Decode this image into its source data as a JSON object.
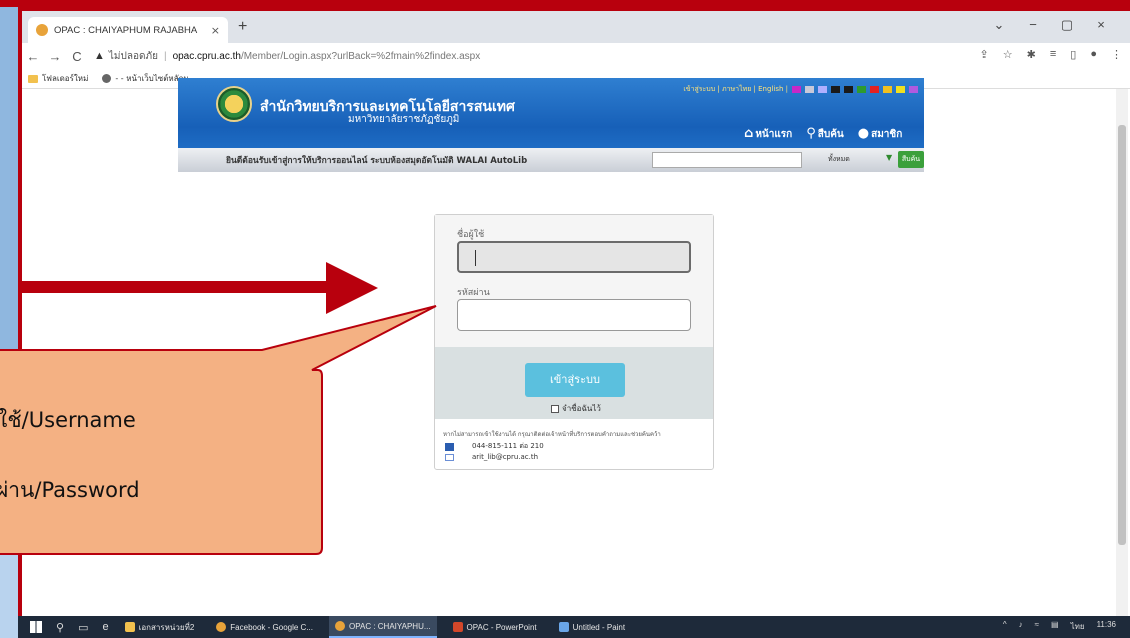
{
  "browser": {
    "tab_title": "OPAC : CHAIYAPHUM RAJABHA",
    "tab_close": "×",
    "new_tab": "+",
    "window_controls": [
      "⌄",
      "−",
      "▢",
      "×"
    ],
    "back": "←",
    "forward": "→",
    "reload": "C",
    "insecure_label": "ไม่ปลอดภัย",
    "url_host": "opac.cpru.ac.th",
    "url_path": "/Member/Login.aspx?urlBack=%2fmain%2findex.aspx",
    "bookmarks": [
      "โฟลเดอร์ใหม่",
      "- - หน้าเว็บไซต์หลักม..."
    ]
  },
  "site": {
    "title": "สำนักวิทยบริการและเทคโนโลยีสารสนเทศ",
    "subtitle": "มหาวิทยาลัยราชภัฏชัยภูมิ",
    "lang_links": "เข้าสู่ระบบ | ภาษาไทย | English |",
    "nav": [
      "หน้าแรก",
      "สืบค้น",
      "สมาชิก"
    ],
    "welcome": "ยินดีต้อนรับเข้าสู่การให้บริการออนไลน์ ระบบห้องสมุดอัตโนมัติ WALAI AutoLib",
    "search_scope": "ทั้งหมด",
    "search_button": "สืบค้น",
    "swatches": [
      "#c728c7",
      "#c9c9d9",
      "#b0b0ff",
      "#1a1a1a",
      "#1a1a1a",
      "#2e9b2e",
      "#e32222",
      "#f0c020",
      "#f0e020",
      "#b05adf"
    ]
  },
  "login": {
    "username_label": "ชื่อผู้ใช้",
    "password_label": "รหัสผ่าน",
    "submit_label": "เข้าสู่ระบบ",
    "remember_label": "จำชื่อฉันไว้",
    "help_text": "หากไม่สามารถเข้าใช้งานได้ กรุณาติดต่อเจ้าหน้าที่บริการตอบคำถามและช่วยค้นคว้า",
    "phone": "044-815-111 ต่อ 210",
    "email": "arit_lib@cpru.ac.th"
  },
  "callout": {
    "line1": "ชื่อผู้ใช้/Username",
    "line2": "รหัสผ่าน/Password"
  },
  "taskbar": {
    "items": [
      "เอกสารหน่วยที่2",
      "Facebook - Google C...",
      "OPAC : CHAIYAPHU...",
      "OPAC - PowerPoint",
      "Untitled - Paint"
    ],
    "lang": "ไทย",
    "time": "11:36"
  }
}
